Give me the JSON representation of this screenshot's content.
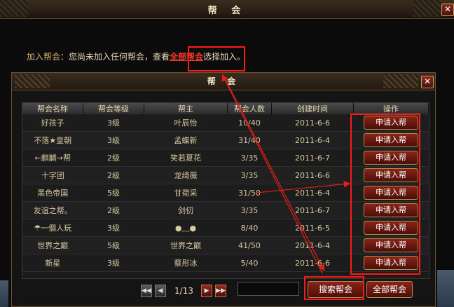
{
  "outer": {
    "title": "帮 会",
    "close": "✕"
  },
  "info": {
    "prefix": "加入帮会",
    "text_before": "：您尚未加入任何帮会，查看",
    "link": "全部帮会",
    "text_after": "选择加入。"
  },
  "dialog": {
    "title": "帮 会",
    "close": "✕"
  },
  "table": {
    "headers": [
      "帮会名称",
      "帮会等级",
      "帮主",
      "帮会人数",
      "创建时间",
      "操作"
    ],
    "rows": [
      {
        "name": "好孩子",
        "level": "3级",
        "leader": "叶辰怡",
        "members": "10/40",
        "created": "2011-6-6",
        "action": "申请入帮"
      },
      {
        "name": "不落★皇朝",
        "level": "3级",
        "leader": "孟蝶新",
        "members": "31/40",
        "created": "2011-6-4",
        "action": "申请入帮"
      },
      {
        "name": "←麒麟→帮",
        "level": "2级",
        "leader": "笑若夏花",
        "members": "3/35",
        "created": "2011-6-7",
        "action": "申请入帮"
      },
      {
        "name": "十字团",
        "level": "2级",
        "leader": "龙绮薇",
        "members": "3/35",
        "created": "2011-6-6",
        "action": "申请入帮"
      },
      {
        "name": "黑色帝国",
        "level": "5级",
        "leader": "甘荷采",
        "members": "31/50",
        "created": "2011-6-4",
        "action": "申请入帮"
      },
      {
        "name": "友谊之帮。",
        "level": "2级",
        "leader": "剑仞",
        "members": "3/35",
        "created": "2011-6-7",
        "action": "申请入帮"
      },
      {
        "name": "☂一個人玩",
        "level": "3级",
        "leader": "●﹏●",
        "members": "8/40",
        "created": "2011-6-5",
        "action": "申请入帮"
      },
      {
        "name": "世界之巅",
        "level": "5级",
        "leader": "世界之巅",
        "members": "41/50",
        "created": "2011-6-4",
        "action": "申请入帮"
      },
      {
        "name": "新星",
        "level": "3级",
        "leader": "蔡彤冰",
        "members": "5/40",
        "created": "2011-6-6",
        "action": "申请入帮"
      }
    ]
  },
  "pager": {
    "first": "◀◀",
    "prev": "◀",
    "page": "1/13",
    "next": "▶",
    "last": "▶▶"
  },
  "buttons": {
    "search": "搜索帮会",
    "all": "全部帮会"
  },
  "colors": {
    "highlight": "#ff1a1a",
    "link": "#ff3b2a",
    "button": "#8a2418"
  }
}
